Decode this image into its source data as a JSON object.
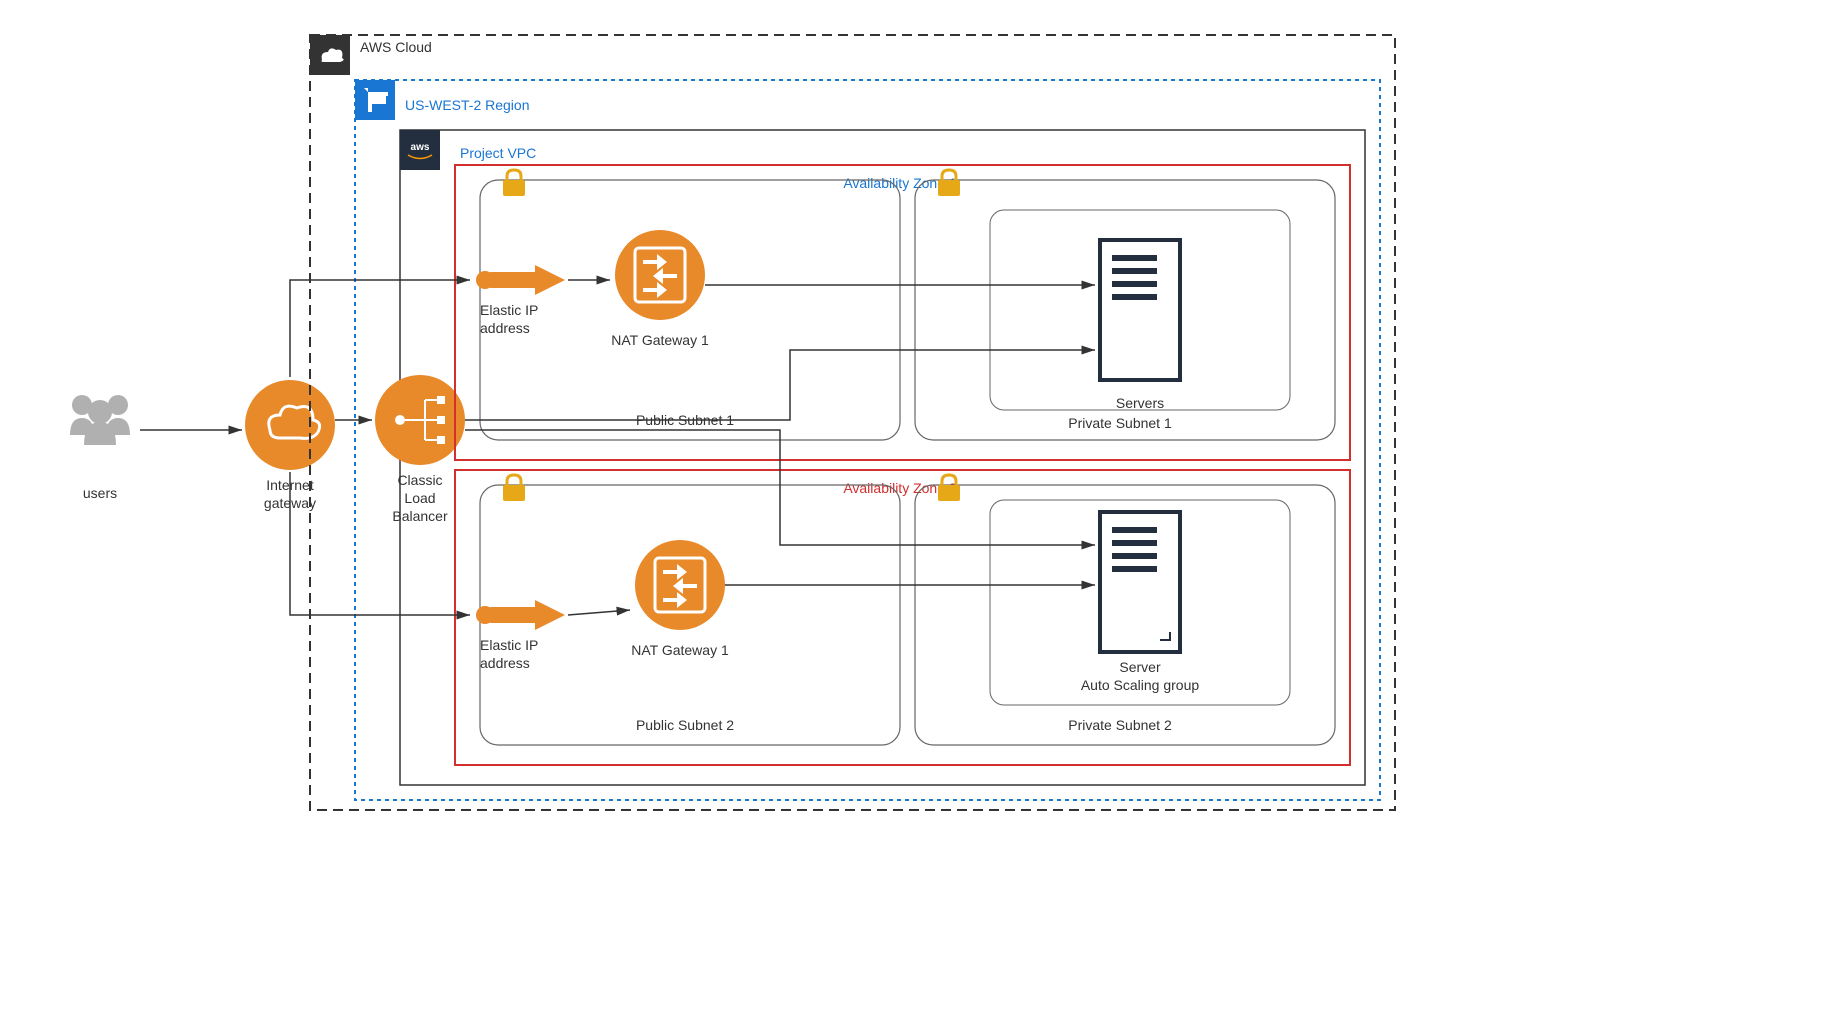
{
  "users": "users",
  "igw": {
    "line1": "Internet",
    "line2": "gateway"
  },
  "clb": {
    "line1": "Classic",
    "line2": "Load",
    "line3": "Balancer"
  },
  "aws_cloud": "AWS Cloud",
  "region": "US-WEST-2 Region",
  "vpc": "Project VPC",
  "az1": {
    "label": "Availability Zone 1",
    "public": "Public Subnet 1",
    "private": "Private Subnet 1",
    "servers": "Servers",
    "eip": {
      "line1": "Elastic IP",
      "line2": "address"
    },
    "nat": "NAT Gateway 1"
  },
  "az2": {
    "label": "Availability Zone 2",
    "public": "Public Subnet 2",
    "private": "Private Subnet 2",
    "server": "Server",
    "asg": "Auto Scaling group",
    "eip": {
      "line1": "Elastic IP",
      "line2": "address"
    },
    "nat": "NAT Gateway 1"
  }
}
